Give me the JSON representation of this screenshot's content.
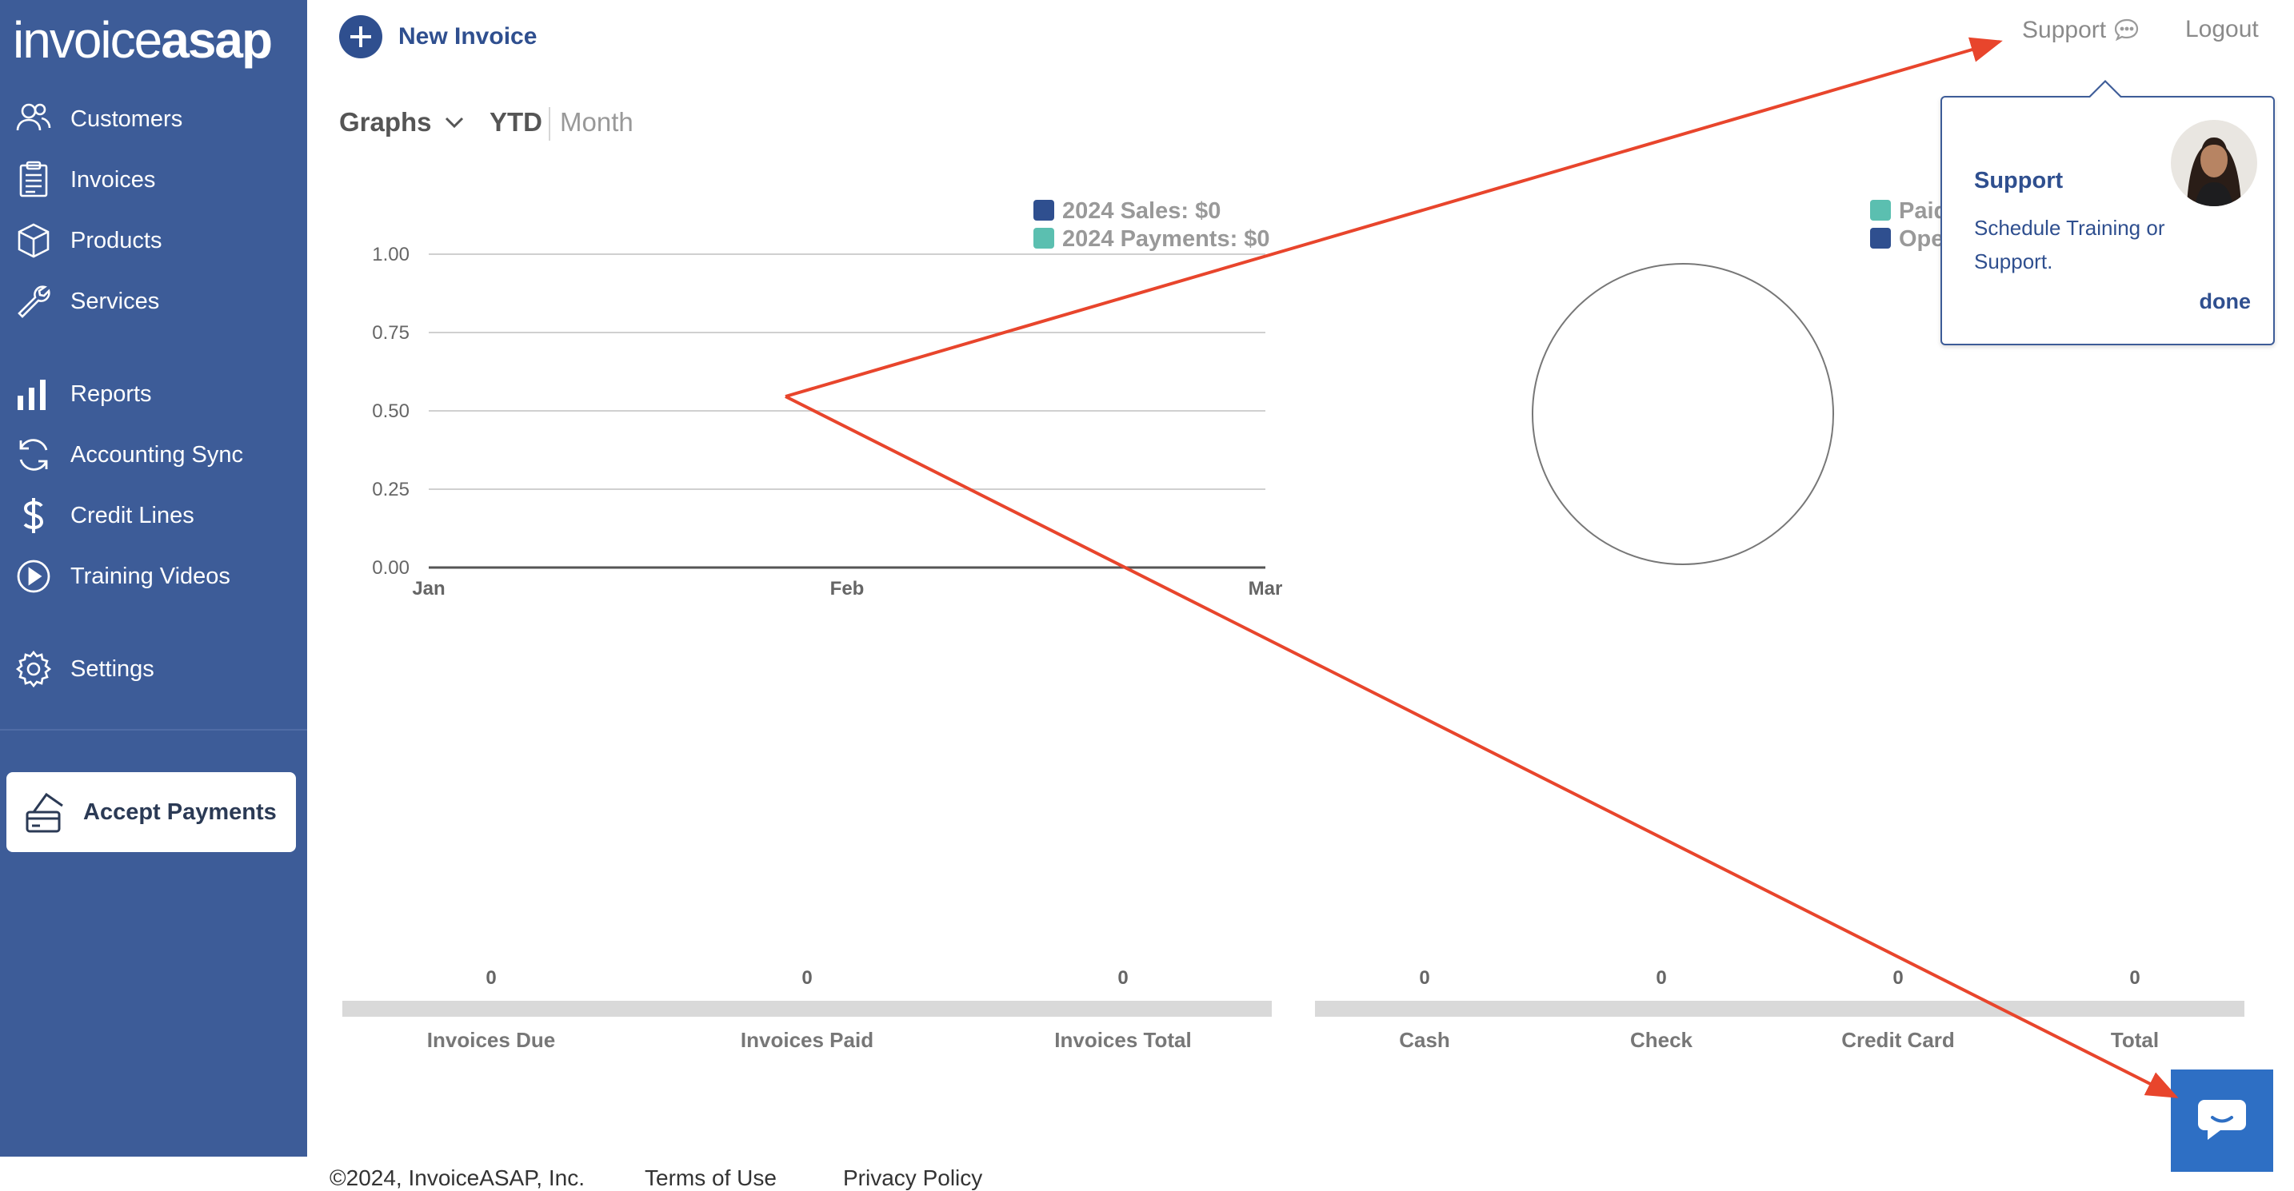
{
  "sidebar": {
    "logo_part1": "invoice",
    "logo_part2": "asap",
    "items": [
      {
        "label": "Customers"
      },
      {
        "label": "Invoices"
      },
      {
        "label": "Products"
      },
      {
        "label": "Services"
      },
      {
        "label": "Reports"
      },
      {
        "label": "Accounting Sync"
      },
      {
        "label": "Credit Lines"
      },
      {
        "label": "Training Videos"
      },
      {
        "label": "Settings"
      }
    ],
    "accept_payments": "Accept Payments"
  },
  "header": {
    "new_invoice": "New Invoice",
    "support": "Support",
    "logout": "Logout"
  },
  "graph_controls": {
    "dropdown": "Graphs",
    "tab_ytd": "YTD",
    "tab_month": "Month",
    "active_tab": "YTD"
  },
  "chart_data": [
    {
      "type": "line",
      "categories": [
        "Jan",
        "Feb",
        "Mar"
      ],
      "series": [
        {
          "name": "2024 Sales: $0",
          "color": "#2f4f8f",
          "values": [
            0,
            0,
            0
          ]
        },
        {
          "name": "2024 Payments: $0",
          "color": "#5bbfb0",
          "values": [
            0,
            0,
            0
          ]
        }
      ],
      "yticks": [
        "1.00",
        "0.75",
        "0.50",
        "0.25",
        "0.00"
      ],
      "ylim": [
        0,
        1
      ],
      "grid": true,
      "legend": "top-right"
    },
    {
      "type": "pie",
      "legend_items": [
        {
          "label": "Paid",
          "color": "#5bbfb0"
        },
        {
          "label": "Open",
          "color": "#2f4f8f"
        }
      ],
      "values": [
        0,
        0
      ],
      "legend": "top-right"
    }
  ],
  "summary": {
    "invoices": [
      {
        "label": "Invoices Due",
        "value": "0"
      },
      {
        "label": "Invoices Paid",
        "value": "0"
      },
      {
        "label": "Invoices Total",
        "value": "0"
      }
    ],
    "payments": [
      {
        "label": "Cash",
        "value": "0"
      },
      {
        "label": "Check",
        "value": "0"
      },
      {
        "label": "Credit Card",
        "value": "0"
      },
      {
        "label": "Total",
        "value": "0"
      }
    ]
  },
  "footer": {
    "copyright": "©2024, InvoiceASAP, Inc.",
    "terms": "Terms of Use",
    "privacy": "Privacy Policy"
  },
  "support_popover": {
    "title": "Support",
    "text": "Schedule Training or Support.",
    "done": "done"
  },
  "colors": {
    "sidebar": "#3d5c98",
    "brand_blue": "#2f4f8f",
    "teal": "#5bbfb0",
    "chat_button": "#2e6fc4",
    "annotation_arrow": "#e8452c"
  }
}
